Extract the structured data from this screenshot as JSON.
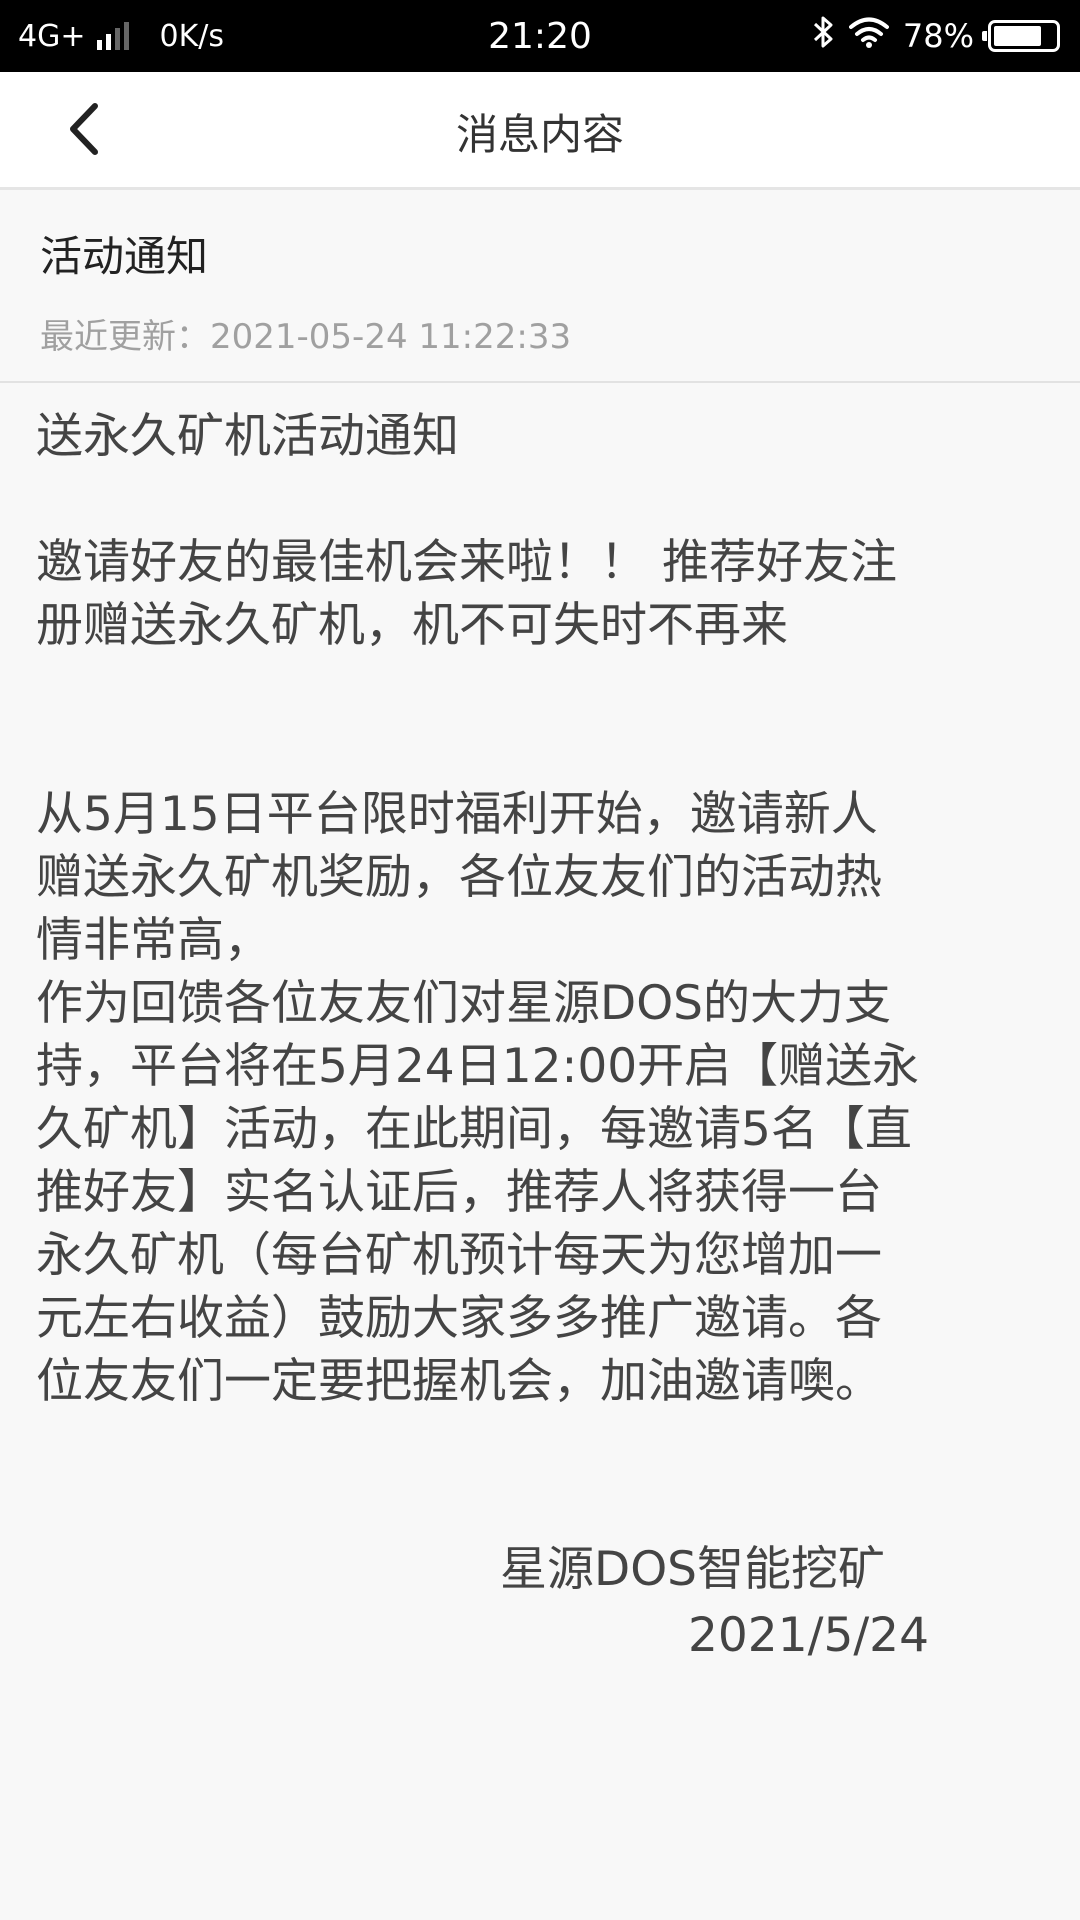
{
  "status_bar": {
    "network": "4G+",
    "speed": "0K/s",
    "time": "21:20",
    "battery": "78%",
    "battery_level": 0.78,
    "icons": [
      "signal-icon",
      "bluetooth-icon",
      "wifi-icon",
      "battery-icon"
    ]
  },
  "nav": {
    "title": "消息内容",
    "back_icon": "chevron-left-icon"
  },
  "message": {
    "title": "活动通知",
    "updated_label": "最近更新：",
    "updated_time": "2021-05-24 11:22:33",
    "heading": "送永久矿机活动通知",
    "intro_line1": "邀请好友的最佳机会来啦！！ 推荐好友注",
    "intro_line2": "册赠送永久矿机，机不可失时不再来",
    "body_lines": [
      "从5月15日平台限时福利开始，邀请新人",
      "赠送永久矿机奖励，各位友友们的活动热",
      "情非常高，",
      "作为回馈各位友友们对星源DOS的大力支",
      "持，平台将在5月24日12:00开启【赠送永",
      "久矿机】活动，在此期间，每邀请5名【直",
      "推好友】实名认证后，推荐人将获得一台",
      "永久矿机（每台矿机预计每天为您增加一",
      "元左右收益）鼓励大家多多推广邀请。各",
      "位友友们一定要把握机会，加油邀请噢。"
    ],
    "signature": "星源DOS智能挖矿",
    "signature_date": "2021/5/24"
  }
}
